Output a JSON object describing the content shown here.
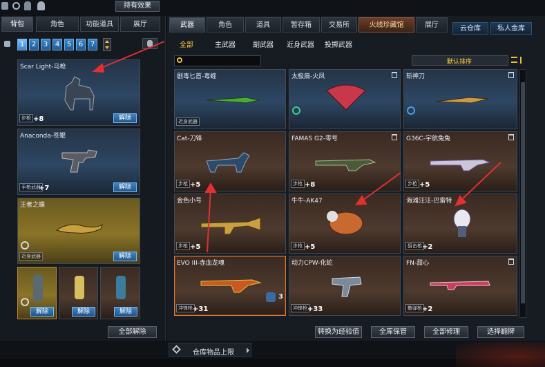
{
  "header": {
    "hold_effect": "持有效果"
  },
  "left_tabs": [
    "背包",
    "角色",
    "功能道具",
    "展厅"
  ],
  "pages": [
    "1",
    "2",
    "3",
    "4",
    "5",
    "6",
    "7"
  ],
  "left_items": [
    {
      "name": "Scar Light-马枪",
      "tag": "步枪",
      "plus": "+8",
      "unlock": "解除"
    },
    {
      "name": "Anaconda-苍鲲",
      "tag": "手枪武器",
      "plus": "+7",
      "unlock": "解除"
    },
    {
      "name": "王者之蝶",
      "tag": "近身武器",
      "plus": "",
      "unlock": "解除"
    }
  ],
  "small_unlock": [
    "解除",
    "解除",
    "解除"
  ],
  "unlock_all": "全部解除",
  "top_tabs": [
    "武器",
    "角色",
    "道具",
    "暂存箱",
    "交易所",
    "火线珍藏馆",
    "展厅"
  ],
  "top_right_tabs": [
    "云仓库",
    "私人金库"
  ],
  "sub_tabs": [
    "全部",
    "主武器",
    "副武器",
    "近身武器",
    "投掷武器"
  ],
  "sort_label": "默认排序",
  "grid": [
    {
      "name": "剧毒匕首-毒蝰",
      "tag": "近身武器",
      "plus": "",
      "trash": false
    },
    {
      "name": "太极扇-火凤",
      "tag": "",
      "plus": "",
      "trash": true
    },
    {
      "name": "斩神刀",
      "tag": "",
      "plus": "",
      "trash": true
    },
    {
      "name": "Cat-刀锋",
      "tag": "步枪",
      "plus": "+5",
      "trash": false
    },
    {
      "name": "FAMAS G2-零号",
      "tag": "步枪",
      "plus": "+8",
      "trash": true
    },
    {
      "name": "G36C-宇航兔兔",
      "tag": "步枪",
      "plus": "+5",
      "trash": true
    },
    {
      "name": "金色小号",
      "tag": "步枪",
      "plus": "+5",
      "trash": false
    },
    {
      "name": "牛牛-AK47",
      "tag": "步枪",
      "plus": "+5",
      "trash": false
    },
    {
      "name": "海滩汪汪-巴雷特",
      "tag": "狙击枪",
      "plus": "+2",
      "trash": false
    },
    {
      "name": "EVO III-赤血龙魂",
      "tag": "冲锋枪",
      "plus": "+31",
      "trash": false,
      "count": "3"
    },
    {
      "name": "动力CPW-化蛇",
      "tag": "冲锋枪",
      "plus": "+33",
      "trash": false
    },
    {
      "name": "FN-甜心",
      "tag": "散弹枪",
      "plus": "+2",
      "trash": true
    }
  ],
  "bottom_buttons": [
    "转换为经验值",
    "全库保管",
    "全部修理",
    "选择翻牌"
  ],
  "storage_limit": "仓库物品上限",
  "colors": {
    "accent": "#3b86c8",
    "arrow": "#e03030",
    "selected_border": "#d07a3a"
  }
}
